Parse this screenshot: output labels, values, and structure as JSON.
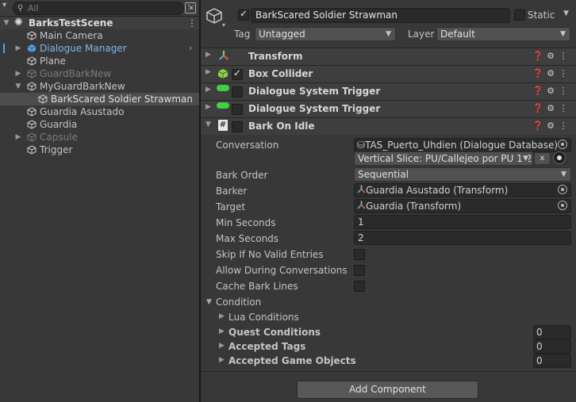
{
  "hierarchy": {
    "search_placeholder": "All",
    "scene_name": "BarksTestScene",
    "items": [
      {
        "label": "Main Camera"
      },
      {
        "label": "Dialogue Manager"
      },
      {
        "label": "Plane"
      },
      {
        "label": "GuardBarkNew"
      },
      {
        "label": "MyGuardBarkNew"
      },
      {
        "label": "BarkScared Soldier Strawman"
      },
      {
        "label": "Guardia Asustado"
      },
      {
        "label": "Guardia"
      },
      {
        "label": "Capsule"
      },
      {
        "label": "Trigger"
      }
    ]
  },
  "inspector": {
    "object_name": "BarkScared Soldier Strawman",
    "static_label": "Static",
    "tag_label": "Tag",
    "tag_value": "Untagged",
    "layer_label": "Layer",
    "layer_value": "Default",
    "components": [
      {
        "name": "Transform"
      },
      {
        "name": "Box Collider"
      },
      {
        "name": "Dialogue System Trigger"
      },
      {
        "name": "Dialogue System Trigger"
      },
      {
        "name": "Bark On Idle"
      }
    ],
    "bark": {
      "conversation_label": "Conversation",
      "conversation_value": "TAS_Puerto_Uhdien (Dialogue Database)",
      "conversation_select": "Vertical Slice: PU/Callejeo por PU 1/2",
      "clear_label": "x",
      "bark_order_label": "Bark Order",
      "bark_order_value": "Sequential",
      "barker_label": "Barker",
      "barker_value": "Guardia Asustado (Transform)",
      "target_label": "Target",
      "target_value": "Guardia (Transform)",
      "min_label": "Min Seconds",
      "min_value": "1",
      "max_label": "Max Seconds",
      "max_value": "2",
      "skip_label": "Skip If No Valid Entries",
      "allow_label": "Allow During Conversations",
      "cache_label": "Cache Bark Lines",
      "condition_label": "Condition",
      "lua_label": "Lua Conditions",
      "quest_label": "Quest Conditions",
      "quest_value": "0",
      "tags_label": "Accepted Tags",
      "tags_value": "0",
      "objects_label": "Accepted Game Objects",
      "objects_value": "0"
    },
    "add_component_label": "Add Component"
  }
}
